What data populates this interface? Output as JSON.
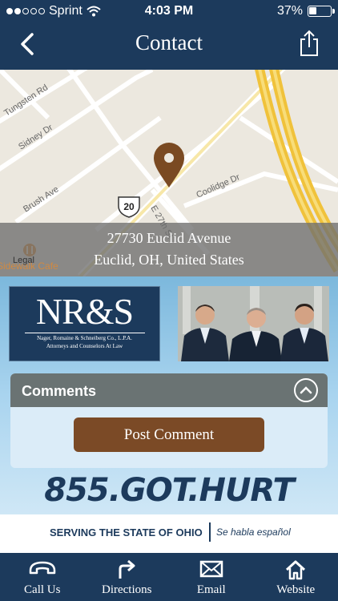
{
  "status_bar": {
    "carrier": "Sprint",
    "time": "4:03 PM",
    "battery_percent": "37%",
    "battery_level": 0.37,
    "signal_bars_filled": 2,
    "signal_bars_total": 5
  },
  "nav": {
    "title": "Contact",
    "back_icon": "chevron-left-icon",
    "share_icon": "share-icon"
  },
  "map": {
    "street_labels": [
      "Tungsten Rd",
      "Sidney Dr",
      "Brush Ave",
      "Coolidge Dr",
      "E 27th St"
    ],
    "route_shield": "20",
    "poi_name": "Sidewalk Cafe",
    "legal_label": "Legal",
    "address_line1": "27730 Euclid Avenue",
    "address_line2": "Euclid, OH, United States"
  },
  "firm": {
    "logo_text": "NR&S",
    "logo_firm_name": "Nager, Romaine & Schneiberg Co., L.P.A.",
    "logo_tagline": "Attorneys and Counselors At Law"
  },
  "comments": {
    "header": "Comments",
    "post_button": "Post Comment"
  },
  "phone_number": "855.GOT.HURT",
  "serving": {
    "text": "SERVING THE STATE OF OHIO",
    "spanish": "Se habla español"
  },
  "tabs": [
    {
      "label": "Call Us",
      "icon": "phone-icon"
    },
    {
      "label": "Directions",
      "icon": "directions-arrow-icon"
    },
    {
      "label": "Email",
      "icon": "envelope-icon"
    },
    {
      "label": "Website",
      "icon": "home-icon"
    }
  ],
  "colors": {
    "navy": "#1c3a5c",
    "brown_button": "#7b4a26",
    "comments_header": "#6a7373",
    "sky_blue": "#7cb8dc"
  }
}
